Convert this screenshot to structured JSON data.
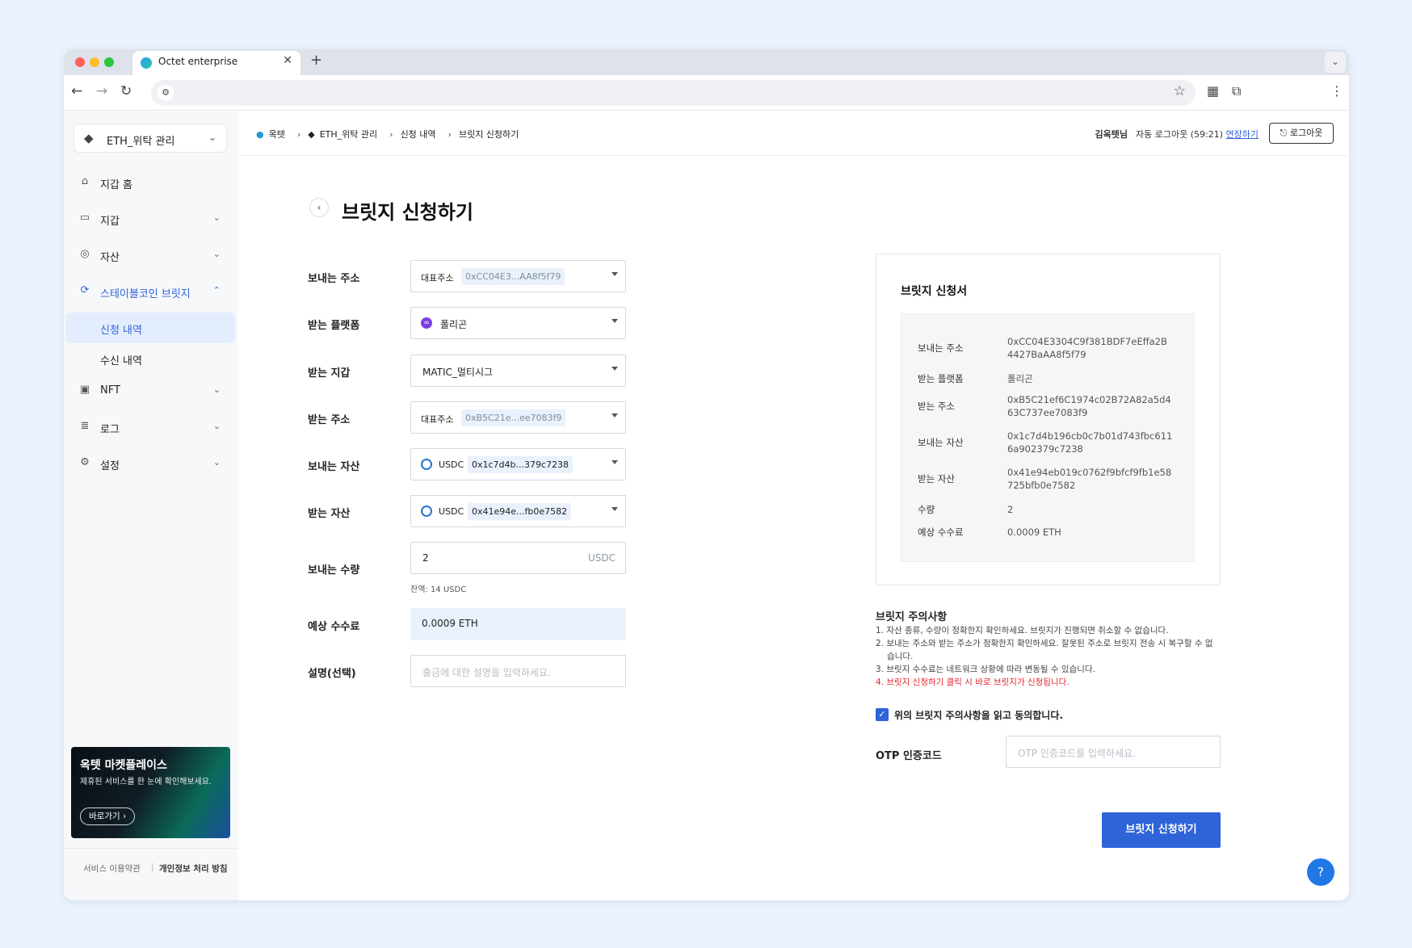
{
  "browser": {
    "tab_title": "Octet enterprise",
    "new_tab": "+",
    "close": "✕"
  },
  "sidebar": {
    "wallet_selector": "ETH_위탁 관리",
    "items": [
      {
        "label": "지갑 홈",
        "icon": "home-icon"
      },
      {
        "label": "지갑",
        "icon": "wallet-icon"
      },
      {
        "label": "자산",
        "icon": "asset-icon"
      },
      {
        "label": "스테이블코인 브릿지",
        "icon": "bridge-icon"
      },
      {
        "label": "NFT",
        "icon": "nft-icon"
      },
      {
        "label": "로그",
        "icon": "log-icon"
      },
      {
        "label": "설정",
        "icon": "settings-icon"
      }
    ],
    "subitems": [
      {
        "label": "신청 내역"
      },
      {
        "label": "수신 내역"
      }
    ],
    "banner": {
      "title": "옥텟 마켓플레이스",
      "subtitle": "제휴된 서비스를 한 눈에 확인해보세요.",
      "button": "바로가기"
    },
    "footer": {
      "terms": "서비스 이용약관",
      "privacy": "개인정보 처리 방침"
    }
  },
  "header": {
    "breadcrumb": [
      "옥텟",
      "ETH_위탁 관리",
      "신청 내역",
      "브릿지 신청하기"
    ],
    "user": "김옥텟님",
    "auto_logout": "자동 로그아웃 (59:21)",
    "extend": "연장하기",
    "logout": "로그아웃"
  },
  "page": {
    "title": "브릿지 신청하기"
  },
  "form": {
    "from_address": {
      "label": "보내는 주소",
      "tag": "대표주소",
      "value": "0xCC04E3...AA8f5f79"
    },
    "to_platform": {
      "label": "받는 플랫폼",
      "value": "폴리곤"
    },
    "to_wallet": {
      "label": "받는 지갑",
      "value": "MATIC_멀티시그"
    },
    "to_address": {
      "label": "받는 주소",
      "tag": "대표주소",
      "value": "0xB5C21e...ee7083f9"
    },
    "send_asset": {
      "label": "보내는 자산",
      "symbol": "USDC",
      "value": "0x1c7d4b...379c7238"
    },
    "receive_asset": {
      "label": "받는 자산",
      "symbol": "USDC",
      "value": "0x41e94e...fb0e7582"
    },
    "amount": {
      "label": "보내는 수량",
      "value": "2",
      "unit": "USDC",
      "balance": "잔액: 14 USDC"
    },
    "fee": {
      "label": "예상 수수료",
      "value": "0.0009 ETH"
    },
    "memo": {
      "label": "설명(선택)",
      "placeholder": "출금에 대한 설명을 입력하세요."
    }
  },
  "summary": {
    "title": "브릿지 신청서",
    "rows": [
      {
        "key": "보내는 주소",
        "value": "0xCC04E3304C9f381BDF7eEffa2B4427BaAA8f5f79"
      },
      {
        "key": "받는 플랫폼",
        "value": "폴리곤"
      },
      {
        "key": "받는 주소",
        "value": "0xB5C21ef6C1974c02B72A82a5d463C737ee7083f9"
      },
      {
        "key": "보내는 자산",
        "value": "0x1c7d4b196cb0c7b01d743fbc6116a902379c7238"
      },
      {
        "key": "받는 자산",
        "value": "0x41e94eb019c0762f9bfcf9fb1e58725bfb0e7582"
      },
      {
        "key": "수량",
        "value": "2"
      },
      {
        "key": "예상 수수료",
        "value": "0.0009 ETH"
      }
    ]
  },
  "notes": {
    "title": "브릿지 주의사항",
    "items": [
      "1. 자산 종류, 수량이 정확한지 확인하세요. 브릿지가 진행되면 취소할 수 없습니다.",
      "2. 보내는 주소와 받는 주소가 정확한지 확인하세요. 잘못된 주소로 브릿지 전송 시 복구할 수 없습니다.",
      "3. 브릿지 수수료는 네트워크 상황에 따라 변동될 수 있습니다.",
      "4. 브릿지 신청하기 클릭 시 바로 브릿지가 신청됩니다."
    ],
    "agree": "위의 브릿지 주의사항을 읽고 동의합니다."
  },
  "otp": {
    "label": "OTP 인증코드",
    "placeholder": "OTP 인증코드를 입력하세요."
  },
  "submit": "브릿지 신청하기",
  "help": "?",
  "colors": {
    "accent": "#2f63d8",
    "danger": "#e5252c",
    "selected_bg": "#e3edfd"
  }
}
